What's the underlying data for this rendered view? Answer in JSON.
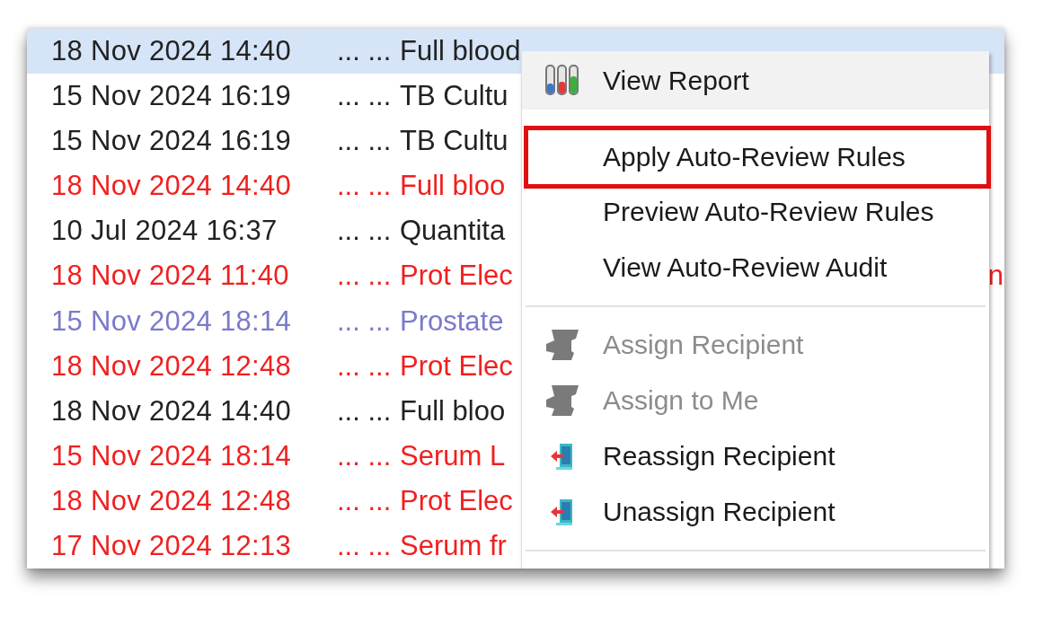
{
  "rows": [
    {
      "date": "18 Nov 2024 14:40",
      "dots": "... ...",
      "test": "Full blood",
      "color": "#222222",
      "selected": true
    },
    {
      "date": "15 Nov 2024 16:19",
      "dots": "... ...",
      "test": "TB Cultu",
      "color": "#222222",
      "selected": false
    },
    {
      "date": "15 Nov 2024 16:19",
      "dots": "... ...",
      "test": "TB Cultu",
      "color": "#222222",
      "selected": false
    },
    {
      "date": "18 Nov 2024 14:40",
      "dots": "... ...",
      "test": "Full bloo",
      "color": "#f02020",
      "selected": false
    },
    {
      "date": "10 Jul 2024 16:37",
      "dots": "... ...",
      "test": "Quantita",
      "color": "#222222",
      "selected": false
    },
    {
      "date": "18 Nov 2024 11:40",
      "dots": "... ...",
      "test": "Prot Elec",
      "tail": "n",
      "color": "#f02020",
      "selected": false
    },
    {
      "date": "15 Nov 2024 18:14",
      "dots": "... ...",
      "test": "Prostate",
      "color": "#7a7acc",
      "selected": false
    },
    {
      "date": "18 Nov 2024 12:48",
      "dots": "... ...",
      "test": "Prot Elec",
      "color": "#f02020",
      "selected": false
    },
    {
      "date": "18 Nov 2024 14:40",
      "dots": "... ...",
      "test": "Full bloo",
      "color": "#222222",
      "selected": false
    },
    {
      "date": "15 Nov 2024 18:14",
      "dots": "... ...",
      "test": "Serum L",
      "color": "#f02020",
      "selected": false
    },
    {
      "date": "18 Nov 2024 12:48",
      "dots": "... ...",
      "test": "Prot Elec",
      "color": "#f02020",
      "selected": false
    },
    {
      "date": "17 Nov 2024 12:13",
      "dots": "... ...",
      "test": "Serum fr",
      "color": "#f02020",
      "selected": false
    }
  ],
  "context_menu": {
    "items": [
      {
        "kind": "report",
        "label": "View Report",
        "disabled": false,
        "hovered": true,
        "highlighted": false
      },
      {
        "kind": "plain",
        "label": "Apply Auto-Review Rules",
        "disabled": false,
        "hovered": false,
        "highlighted": true
      },
      {
        "kind": "plain",
        "label": "Preview Auto-Review Rules",
        "disabled": false,
        "hovered": false,
        "highlighted": false
      },
      {
        "kind": "plain",
        "label": "View Auto-Review Audit",
        "disabled": false,
        "hovered": false,
        "highlighted": false
      },
      {
        "kind": "separator"
      },
      {
        "kind": "assign",
        "label": "Assign Recipient",
        "disabled": true,
        "hovered": false,
        "highlighted": false
      },
      {
        "kind": "assign",
        "label": "Assign to Me",
        "disabled": true,
        "hovered": false,
        "highlighted": false
      },
      {
        "kind": "recipient",
        "label": "Reassign Recipient",
        "disabled": false,
        "hovered": false,
        "highlighted": false
      },
      {
        "kind": "recipient",
        "label": "Unassign Recipient",
        "disabled": false,
        "hovered": false,
        "highlighted": false
      },
      {
        "kind": "separator"
      }
    ]
  }
}
